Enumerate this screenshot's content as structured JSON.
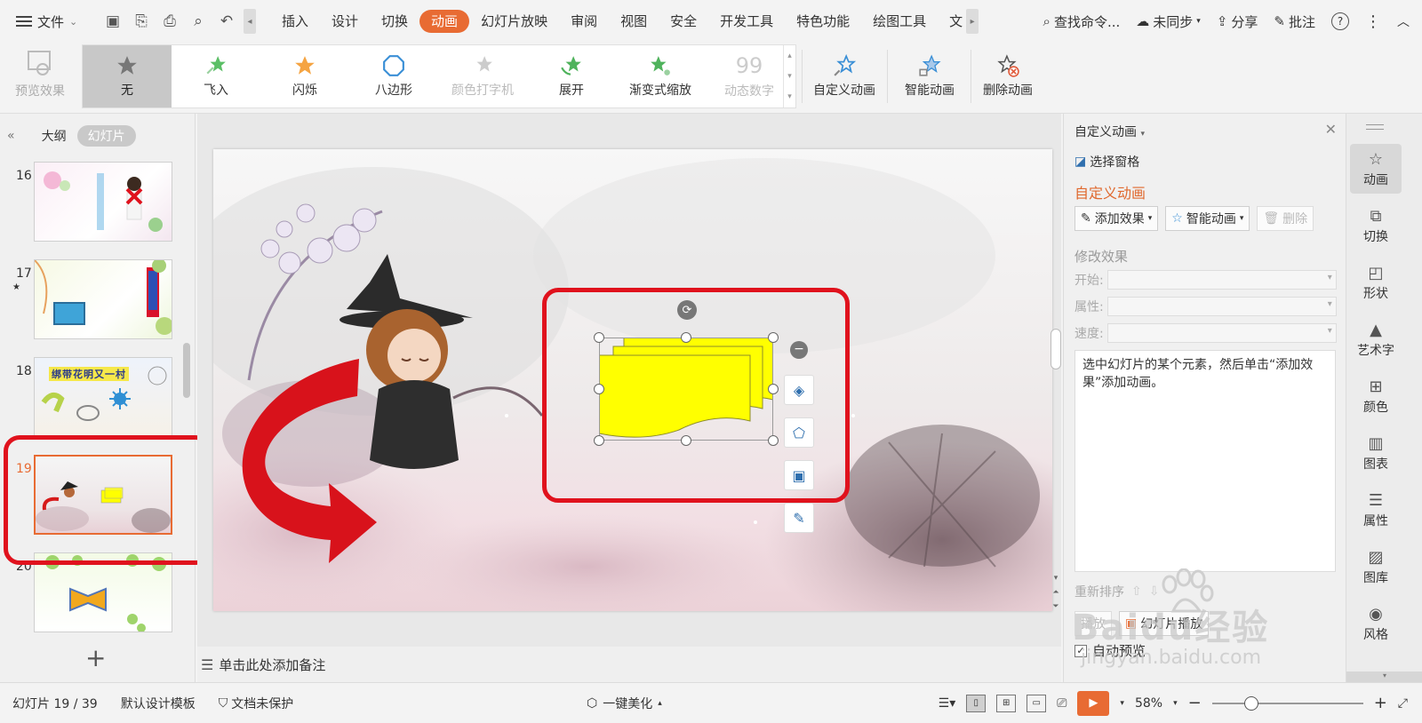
{
  "menu": {
    "file_label": "文件",
    "tabs": [
      "插入",
      "设计",
      "切换",
      "动画",
      "幻灯片放映",
      "审阅",
      "视图",
      "安全",
      "开发工具",
      "特色功能",
      "绘图工具",
      "文"
    ],
    "active_tab": "动画",
    "search_placeholder": "查找命令...",
    "sync_label": "未同步",
    "share_label": "分享",
    "comment_label": "批注",
    "help_symbol": "?"
  },
  "ribbon": {
    "preview_label": "预览效果",
    "gallery": [
      {
        "label": "无",
        "state": "selected"
      },
      {
        "label": "飞入",
        "state": "normal"
      },
      {
        "label": "闪烁",
        "state": "normal"
      },
      {
        "label": "八边形",
        "state": "normal"
      },
      {
        "label": "颜色打字机",
        "state": "disabled"
      },
      {
        "label": "展开",
        "state": "normal"
      },
      {
        "label": "渐变式缩放",
        "state": "normal"
      },
      {
        "label": "动态数字",
        "state": "disabled"
      }
    ],
    "custom_anim_label": "自定义动画",
    "smart_anim_label": "智能动画",
    "delete_anim_label": "删除动画"
  },
  "left_panel": {
    "outline_tab": "大纲",
    "slides_tab": "幻灯片",
    "slides": [
      {
        "number": "16",
        "selected": false
      },
      {
        "number": "17",
        "selected": false
      },
      {
        "number": "18",
        "selected": false
      },
      {
        "number": "19",
        "selected": true
      },
      {
        "number": "20",
        "selected": false
      }
    ],
    "slide18_caption": "绑带花明又一村",
    "add_symbol": "+"
  },
  "canvas": {
    "notes_placeholder": "单击此处添加备注"
  },
  "right_panel": {
    "header": "自定义动画",
    "select_pane": "选择窗格",
    "section_title": "自定义动画",
    "add_effect": "添加效果",
    "smart_anim": "智能动画",
    "delete": "删除",
    "modify_title": "修改效果",
    "start_label": "开始:",
    "property_label": "属性:",
    "speed_label": "速度:",
    "hint": "选中幻灯片的某个元素，然后单击“添加效果”添加动画。",
    "reorder_label": "重新排序",
    "play_label": "播放",
    "slideshow_label": "幻灯片播放",
    "auto_preview_label": "自动预览",
    "auto_preview_checked": true
  },
  "sidebar": {
    "items": [
      "动画",
      "切换",
      "形状",
      "艺术字",
      "颜色",
      "图表",
      "属性",
      "图库",
      "风格"
    ],
    "active": "动画"
  },
  "status": {
    "slide_info": "幻灯片 19 / 39",
    "template": "默认设计模板",
    "protect": "文档未保护",
    "beautify": "一键美化",
    "zoom": "58%"
  },
  "watermark": {
    "brand": "Baidu经验",
    "url": "jingyan.baidu.com"
  },
  "colors": {
    "accent": "#e86b33",
    "callout_red": "#e0121d",
    "shape_yellow": "#ffff00"
  }
}
